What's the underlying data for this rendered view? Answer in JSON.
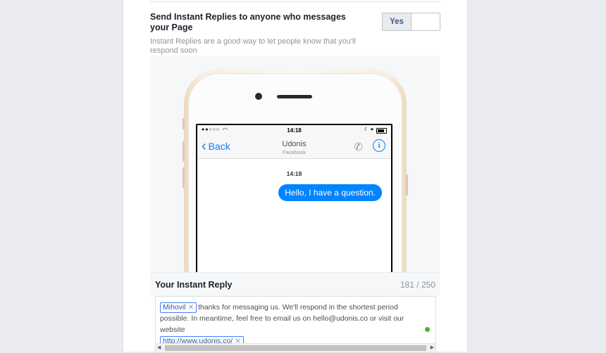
{
  "setting": {
    "title": "Send Instant Replies to anyone who messages your Page",
    "description": "Instant Replies are a good way to let people know that you'll respond soon",
    "toggle_yes_label": "Yes"
  },
  "phone_preview": {
    "status_time": "14:18",
    "back_label": "Back",
    "contact_name": "Udonis",
    "contact_subtitle": "Facebook",
    "message_time": "14:18",
    "message_text": "Hello, I have a question."
  },
  "reply": {
    "label": "Your Instant Reply",
    "char_count": "181 / 250",
    "token_name": "Mihovil",
    "body_text": "thanks for messaging us. We'll respond in the shortest period possible. In meantime, feel free to email us on hello@udonis.co or visit our website",
    "token_url": "http://www.udonis.co/"
  },
  "colors": {
    "messenger_blue": "#0084ff",
    "facebook_link": "#365899",
    "status_green": "#42b72a"
  }
}
